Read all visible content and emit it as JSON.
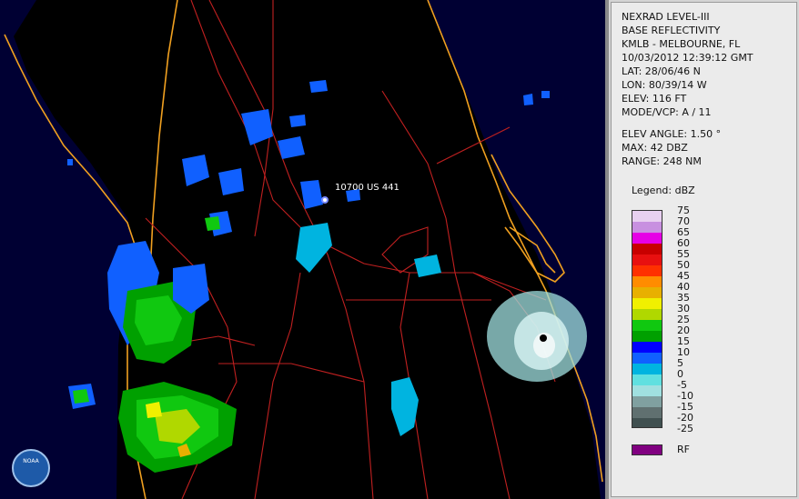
{
  "header": {
    "line1": "NEXRAD LEVEL-III",
    "line2": "BASE REFLECTIVITY",
    "station": "KMLB - MELBOURNE, FL",
    "datetime": "10/03/2012 12:39:12 GMT",
    "lat": "LAT: 28/06/46 N",
    "lon": "LON: 80/39/14 W",
    "elev": "ELEV: 116 FT",
    "mode": "MODE/VCP: A / 11"
  },
  "scan": {
    "elev_angle": "ELEV ANGLE: 1.50 °",
    "max": "MAX: 42 DBZ",
    "range": "RANGE: 248 NM"
  },
  "legend": {
    "title": "Legend: dBZ",
    "labels": [
      "75",
      "70",
      "65",
      "60",
      "55",
      "50",
      "45",
      "40",
      "35",
      "30",
      "25",
      "20",
      "15",
      "10",
      "5",
      "0",
      "-5",
      "-10",
      "-15",
      "-20",
      "-25"
    ],
    "colors": [
      "#e8d0f0",
      "#c890e0",
      "#e600e6",
      "#c80000",
      "#e81010",
      "#ff3000",
      "#ff8c00",
      "#e8b000",
      "#f0f000",
      "#b0d800",
      "#10c810",
      "#00a000",
      "#0000ff",
      "#1060ff",
      "#00b4e0",
      "#60e0e0",
      "#a0e0e0",
      "#80a0a0",
      "#607070",
      "#405050",
      "#202020"
    ],
    "rf_label": "RF",
    "rf_color": "#800080"
  },
  "map": {
    "location_label": "10700 US 441",
    "logo_text": "NOAA",
    "ocean_color": "#000033",
    "land_color": "#000000",
    "coast_color": "#f0a020",
    "road_color": "#c02020"
  }
}
